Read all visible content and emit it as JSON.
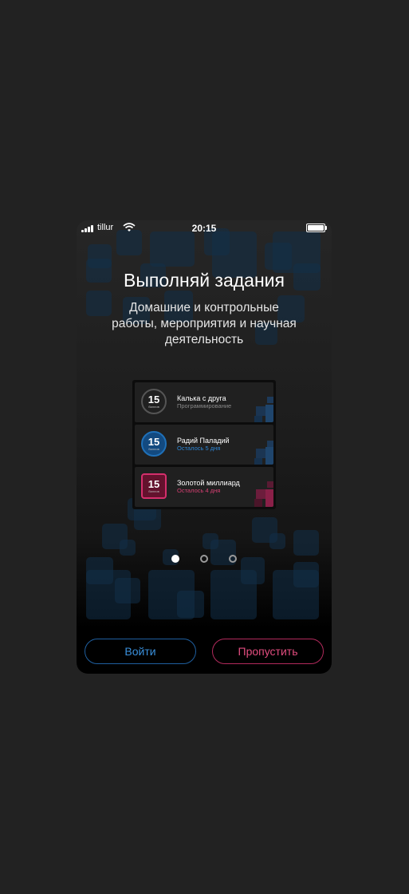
{
  "status_bar": {
    "carrier": "tillur",
    "time": "20:15"
  },
  "onboarding": {
    "title": "Выполняй задания",
    "subtitle": "Домашние и контрольные работы, мероприятия и научная деятельность"
  },
  "tasks": [
    {
      "points": "15",
      "points_unit": "баллов",
      "title": "Калька с друга",
      "subtitle": "Программирование",
      "style": "gray"
    },
    {
      "points": "15",
      "points_unit": "баллов",
      "title": "Радий Паладий",
      "subtitle": "Осталось 5 дня",
      "style": "blue"
    },
    {
      "points": "15",
      "points_unit": "баллов",
      "title": "Золотой миллиард",
      "subtitle": "Осталось 4 дня",
      "style": "red"
    }
  ],
  "pagination": {
    "current_page": 1,
    "total_pages": 3
  },
  "buttons": {
    "login": "Войти",
    "skip": "Пропустить"
  },
  "colors": {
    "background": "#222222",
    "accent_blue": "#2d86d6",
    "accent_red": "#d63f72"
  },
  "icons": [
    "signal-icon",
    "wifi-icon",
    "battery-icon"
  ]
}
